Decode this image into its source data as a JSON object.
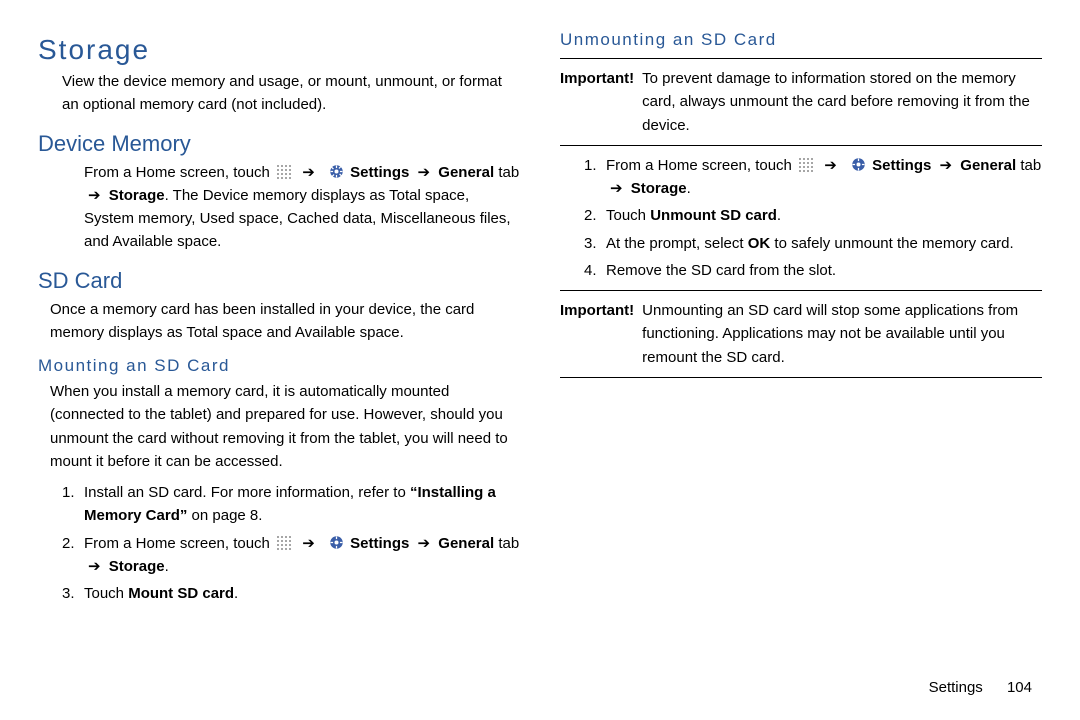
{
  "title": "Storage",
  "intro": "View the device memory and usage, or mount, unmount, or format an optional memory card (not included).",
  "device_memory": {
    "heading": "Device Memory",
    "step1_pre": "From a Home screen, touch",
    "settings": "Settings",
    "arrow": "➔",
    "general": "General",
    "tab": " tab ",
    "storage": "Storage",
    "step1_post": ". The Device memory displays as Total space, System memory, Used space, Cached data, Miscellaneous files, and Available space."
  },
  "sdcard": {
    "heading": "SD Card",
    "intro": "Once a memory card has been installed in your device, the card memory displays as Total space and Available space."
  },
  "mounting": {
    "heading": "Mounting an SD Card",
    "intro": "When you install a memory card, it is automatically mounted (connected to the tablet) and prepared for use. However, should you unmount the card without removing it from the tablet, you will need to mount it before it can be accessed.",
    "step1a": "Install an SD card. For more information, refer to ",
    "step1b": "“Installing a Memory Card”",
    "step1c": " on page 8.",
    "step2_pre": "From a Home screen, touch",
    "settings": "Settings",
    "arrow": "➔",
    "general": "General",
    "tab": " tab ",
    "storage": "Storage",
    "step3_pre": "Touch ",
    "step3_bold": "Mount SD card",
    "step3_post": "."
  },
  "unmounting": {
    "heading": "Unmounting an SD Card",
    "important1_label": "Important!",
    "important1_body": "To prevent damage to information stored on the memory card, always unmount the card before removing it from the device.",
    "step1_pre": "From a Home screen, touch",
    "settings": "Settings",
    "arrow": "➔",
    "general": "General",
    "tab": " tab ",
    "storage": "Storage",
    "step2_pre": "Touch ",
    "step2_bold": "Unmount SD card",
    "step2_post": ".",
    "step3_pre": "At the prompt, select ",
    "step3_bold": "OK",
    "step3_post": " to safely unmount the memory card.",
    "step4": "Remove the SD card from the slot.",
    "important2_label": "Important!",
    "important2_body": "Unmounting an SD card will stop some applications from functioning. Applications may not be available until you remount the SD card."
  },
  "footer": {
    "section": "Settings",
    "page": "104"
  }
}
